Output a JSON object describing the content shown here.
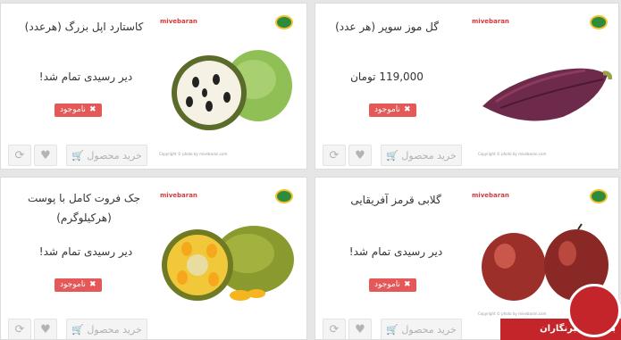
{
  "brand": {
    "logo": "mivebaran",
    "copyright": "Copyright © photo by mivebaran.com"
  },
  "products": [
    {
      "title": "گل موز سوپر (هر عدد)",
      "price": "119,000 تومان",
      "soon": "",
      "badge": "ناموجود",
      "buy": "خرید محصول"
    },
    {
      "title": "کاستارد اپل بزرگ (هرعدد)",
      "price": "",
      "soon": "دیر رسیدی تمام شد!",
      "badge": "ناموجود",
      "buy": "خرید محصول"
    },
    {
      "title": "گلابی قرمز آفریقایی",
      "price": "",
      "soon": "دیر رسیدی تمام شد!",
      "badge": "ناموجود",
      "buy": "خرید محصول"
    },
    {
      "title": "جک فروت کامل با پوست (هرکیلوگرم)",
      "price": "",
      "soon": "دیر رسیدی تمام شد!",
      "badge": "ناموجود",
      "buy": "خرید محصول"
    }
  ],
  "footer": {
    "label": "باشگاه خبرنگاران"
  }
}
